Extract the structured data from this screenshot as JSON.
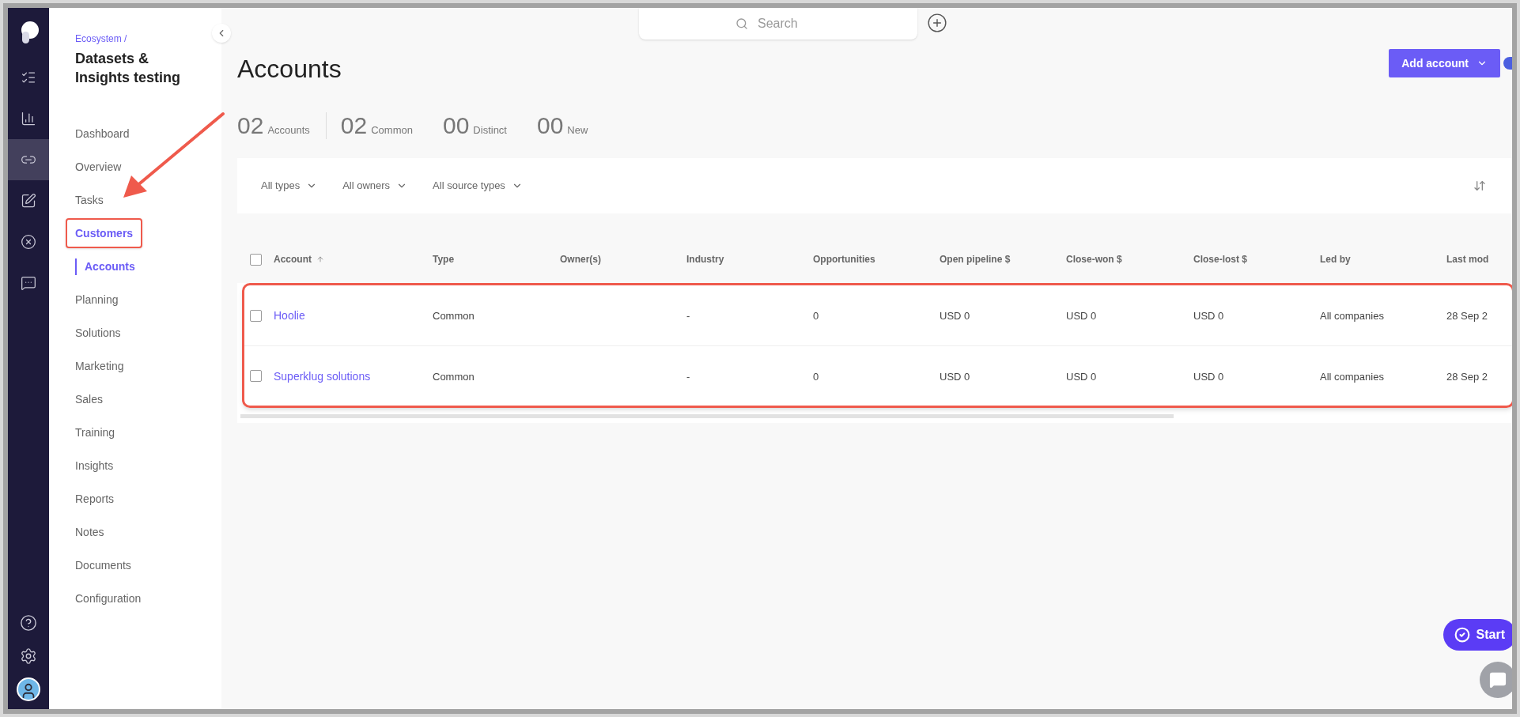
{
  "rail": [
    {
      "selected": false
    },
    {
      "selected": false
    },
    {
      "selected": true
    },
    {
      "selected": false
    },
    {
      "selected": false
    },
    {
      "selected": false
    }
  ],
  "breadcrumb": "Ecosystem /",
  "workspace_title": "Datasets & Insights testing",
  "nav": [
    {
      "label": "Dashboard",
      "selected": false
    },
    {
      "label": "Overview",
      "selected": false
    },
    {
      "label": "Tasks",
      "selected": false
    },
    {
      "label": "Customers",
      "selected": true,
      "annotated": true,
      "children": [
        {
          "label": "Accounts",
          "selected": true
        }
      ]
    },
    {
      "label": "Planning",
      "selected": false
    },
    {
      "label": "Solutions",
      "selected": false
    },
    {
      "label": "Marketing",
      "selected": false
    },
    {
      "label": "Sales",
      "selected": false
    },
    {
      "label": "Training",
      "selected": false
    },
    {
      "label": "Insights",
      "selected": false
    },
    {
      "label": "Reports",
      "selected": false
    },
    {
      "label": "Notes",
      "selected": false
    },
    {
      "label": "Documents",
      "selected": false
    },
    {
      "label": "Configuration",
      "selected": false
    }
  ],
  "search": {
    "placeholder": "Search"
  },
  "page_title": "Accounts",
  "add_button": "Add account",
  "stats": [
    {
      "value": "02",
      "label": "Accounts"
    },
    {
      "value": "02",
      "label": "Common"
    },
    {
      "value": "00",
      "label": "Distinct"
    },
    {
      "value": "00",
      "label": "New"
    }
  ],
  "filters": [
    "All types",
    "All owners",
    "All source types"
  ],
  "table": {
    "select_all_checked": false,
    "columns": [
      "Account",
      "Type",
      "Owner(s)",
      "Industry",
      "Opportunities",
      "Open pipeline $",
      "Close-won $",
      "Close-lost $",
      "Led by",
      "Last mod"
    ],
    "rows": [
      {
        "checked": false,
        "cells": [
          "Hoolie",
          "Common",
          "",
          "-",
          "0",
          "USD 0",
          "USD 0",
          "USD 0",
          "All companies",
          "28 Sep 2"
        ]
      },
      {
        "checked": false,
        "cells": [
          "Superklug solutions",
          "Common",
          "",
          "-",
          "0",
          "USD 0",
          "USD 0",
          "USD 0",
          "All companies",
          "28 Sep 2"
        ]
      }
    ]
  },
  "start_button": "Start"
}
